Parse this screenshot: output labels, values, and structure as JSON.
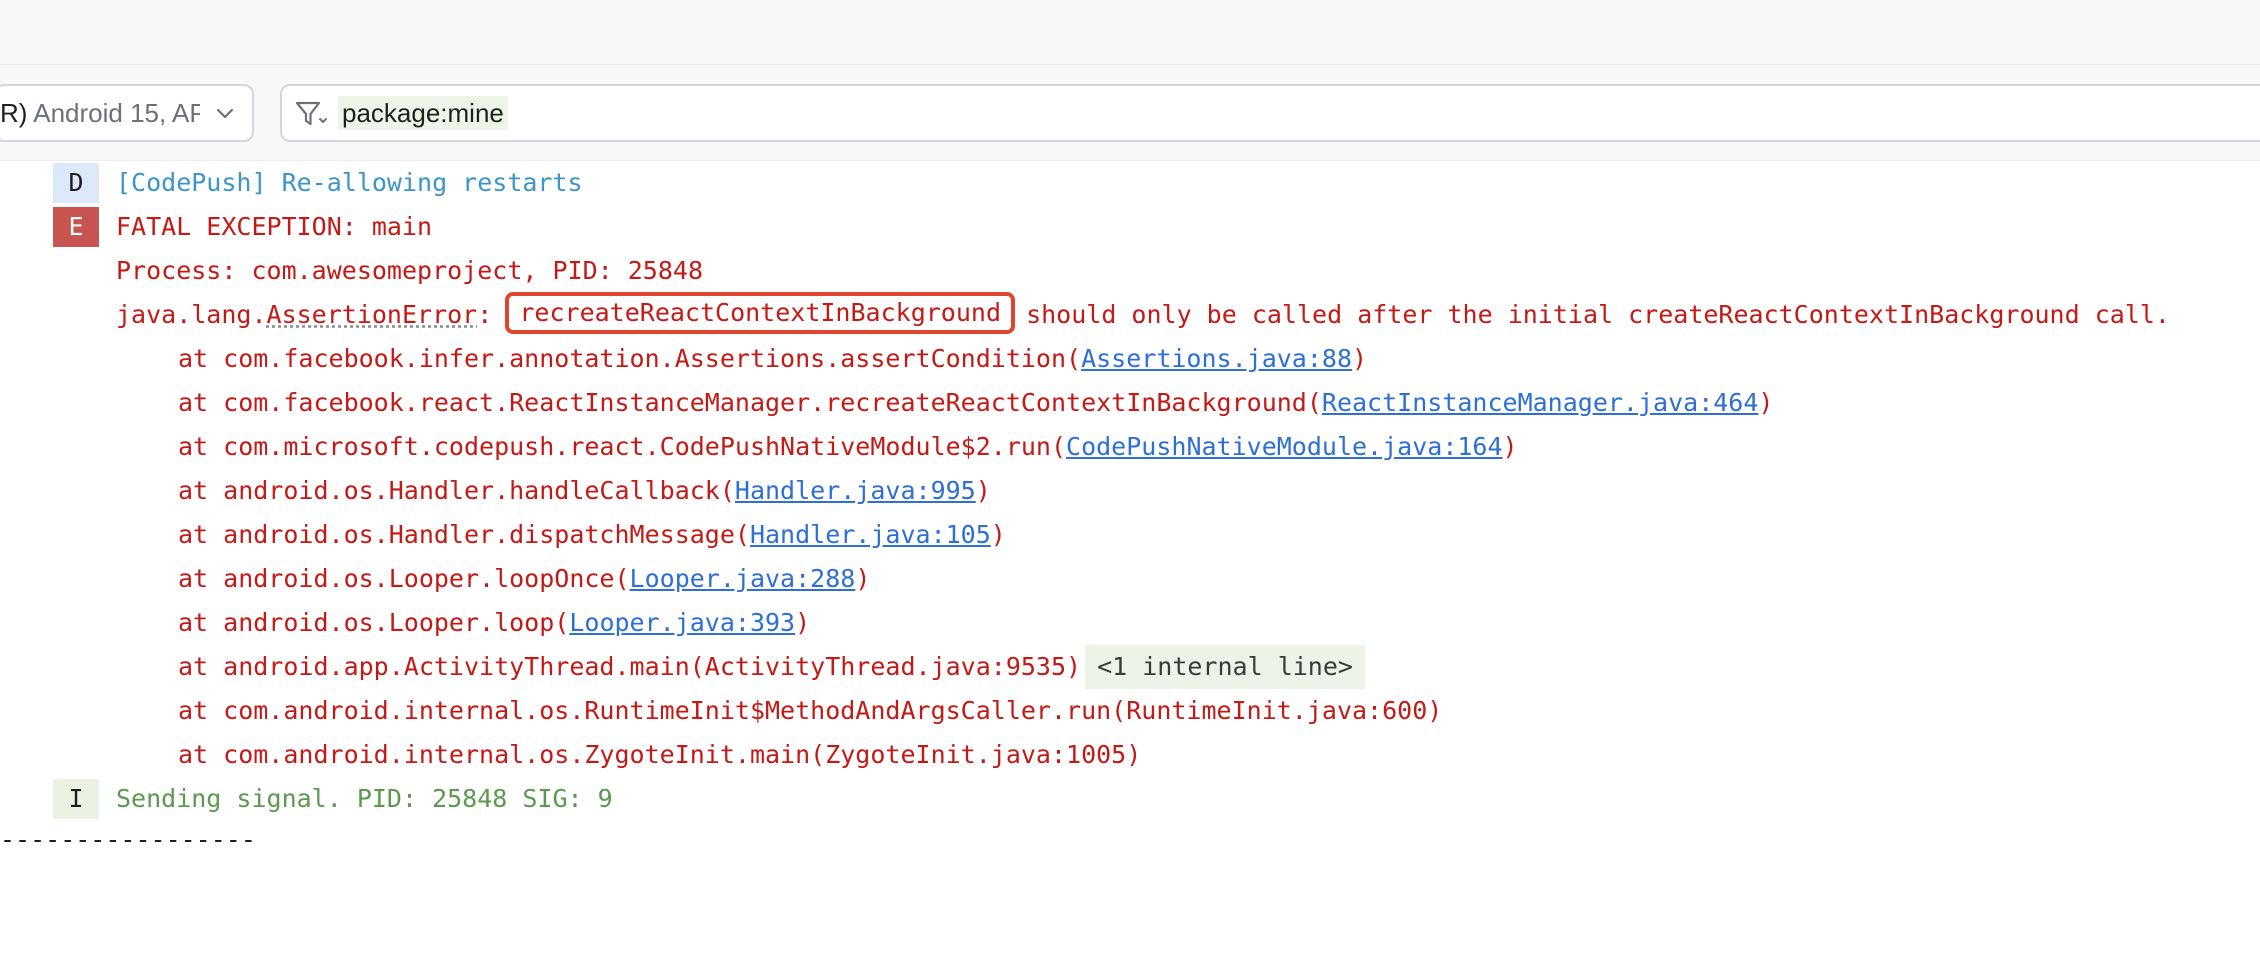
{
  "toolbar": {
    "device_prefix": "R)",
    "device_label": "Android 15, AP",
    "filter_query": "package:mine"
  },
  "log": {
    "debug_line": {
      "level": "D",
      "text": "[CodePush] Re-allowing restarts"
    },
    "fatal_line": {
      "level": "E",
      "text": "FATAL EXCEPTION: main"
    },
    "process_line": "Process: com.awesomeproject, PID: 25848",
    "assertion": {
      "prefix": "java.lang.",
      "class_name": "AssertionError",
      "colon": ":",
      "highlighted": "recreateReactContextInBackground",
      "rest": "should only be called after the initial createReactContextInBackground call."
    },
    "stack": [
      {
        "before": "at com.facebook.infer.annotation.Assertions.assertCondition(",
        "link": "Assertions.java:88",
        "after": ")"
      },
      {
        "before": "at com.facebook.react.ReactInstanceManager.recreateReactContextInBackground(",
        "link": "ReactInstanceManager.java:464",
        "after": ")"
      },
      {
        "before": "at com.microsoft.codepush.react.CodePushNativeModule$2.run(",
        "link": "CodePushNativeModule.java:164",
        "after": ")"
      },
      {
        "before": "at android.os.Handler.handleCallback(",
        "link": "Handler.java:995",
        "after": ")"
      },
      {
        "before": "at android.os.Handler.dispatchMessage(",
        "link": "Handler.java:105",
        "after": ")"
      },
      {
        "before": "at android.os.Looper.loopOnce(",
        "link": "Looper.java:288",
        "after": ")"
      },
      {
        "before": "at android.os.Looper.loop(",
        "link": "Looper.java:393",
        "after": ")"
      },
      {
        "before": "at android.app.ActivityThread.main(ActivityThread.java:9535)",
        "chip": "<1 internal line>"
      },
      {
        "before": "at com.android.internal.os.RuntimeInit$MethodAndArgsCaller.run(RuntimeInit.java:600)"
      },
      {
        "before": "at com.android.internal.os.ZygoteInit.main(ZygoteInit.java:1005)"
      }
    ],
    "info_line": {
      "level": "I",
      "text": "Sending signal. PID: 25848 SIG: 9"
    },
    "separator": "-----------------"
  },
  "icons": {
    "filter": "filter-icon",
    "dropdown": "chevron-down-icon"
  },
  "colors": {
    "error_text": "#c41a16",
    "debug_text": "#3d94c7",
    "info_text": "#5b9a4e",
    "link": "#2d6fd6",
    "highlight_border": "#e0452f"
  }
}
